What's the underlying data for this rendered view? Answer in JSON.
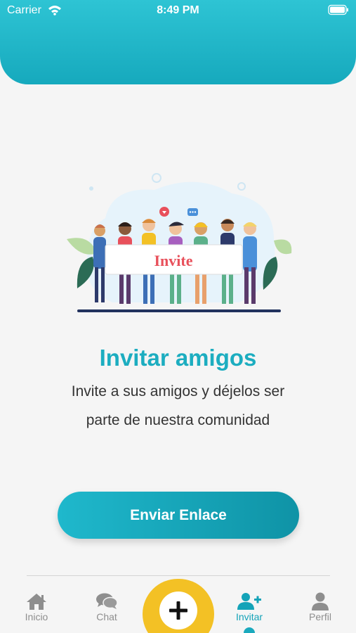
{
  "status_bar": {
    "carrier": "Carrier",
    "time": "8:49 PM"
  },
  "illustration": {
    "banner_text": "Invite"
  },
  "content": {
    "title": "Invitar amigos",
    "description_line1": "Invite a sus amigos y déjelos ser",
    "description_line2": "parte de nuestra comunidad"
  },
  "send_button": {
    "label": "Enviar Enlace"
  },
  "tabbar": {
    "items": [
      {
        "label": "Inicio",
        "icon": "home-icon"
      },
      {
        "label": "Chat",
        "icon": "chat-icon"
      },
      {
        "label": "",
        "icon": "plus-icon"
      },
      {
        "label": "Invitar",
        "icon": "add-user-icon"
      },
      {
        "label": "Perfil",
        "icon": "person-icon"
      }
    ],
    "active": "Invitar"
  },
  "colors": {
    "accent": "#1cadc0",
    "center_button": "#f3c125",
    "tab_inactive": "#8e8e8e"
  }
}
